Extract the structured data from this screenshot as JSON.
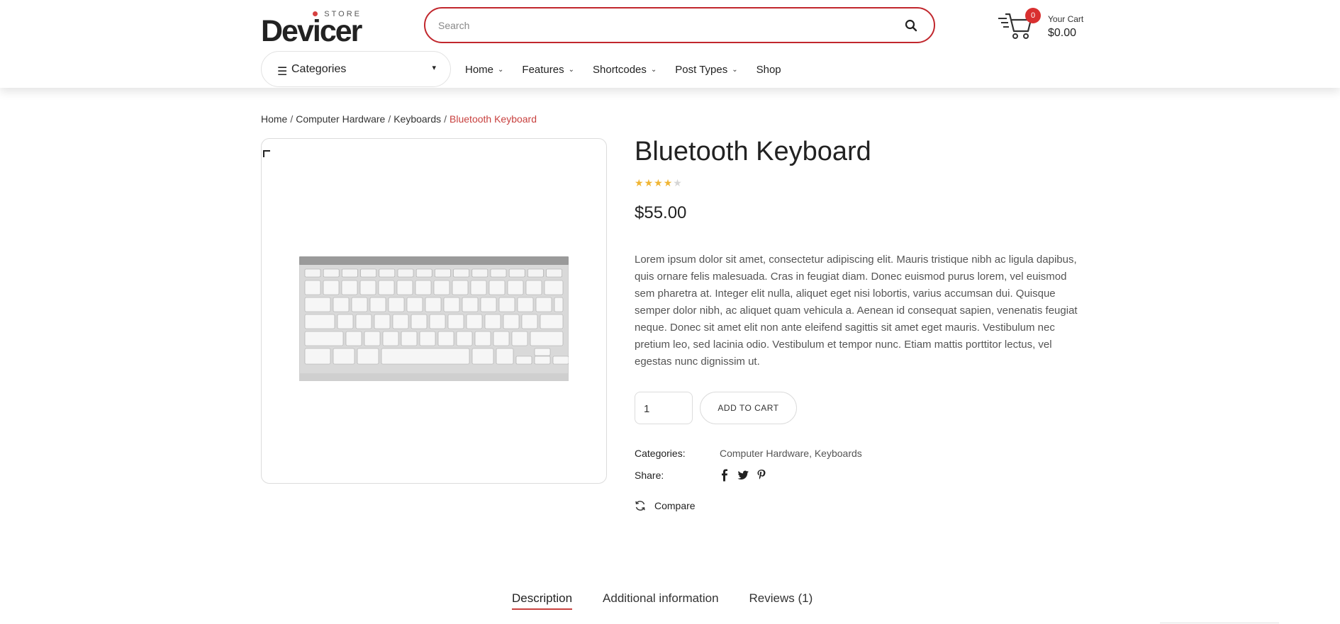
{
  "header": {
    "logo": {
      "store": "STORE",
      "name": "Devicer"
    },
    "search": {
      "placeholder": "Search",
      "value": ""
    },
    "cart": {
      "count": "0",
      "label": "Your Cart",
      "amount": "$0.00"
    },
    "categories_label": "Categories",
    "nav": [
      {
        "label": "Home",
        "has_dropdown": true
      },
      {
        "label": "Features",
        "has_dropdown": true
      },
      {
        "label": "Shortcodes",
        "has_dropdown": true
      },
      {
        "label": "Post Types",
        "has_dropdown": true
      },
      {
        "label": "Shop",
        "has_dropdown": false
      }
    ]
  },
  "breadcrumb": {
    "items": [
      "Home",
      "Computer Hardware",
      "Keyboards"
    ],
    "separator": "/",
    "current": "Bluetooth Keyboard"
  },
  "product": {
    "title": "Bluetooth Keyboard",
    "rating": 4,
    "rating_max": 5,
    "price": "$55.00",
    "description": "Lorem ipsum dolor sit amet, consectetur adipiscing elit. Mauris tristique nibh ac ligula dapibus, quis ornare felis malesuada. Cras in feugiat diam. Donec euismod purus lorem, vel euismod sem pharetra at. Integer elit nulla, aliquet eget nisi lobortis, varius accumsan dui. Quisque semper dolor nibh, ac aliquet quam vehicula a. Aenean id consequat sapien, venenatis feugiat neque. Donec sit amet elit non ante eleifend sagittis sit amet eget mauris. Vestibulum nec pretium leo, sed lacinia odio. Vestibulum et tempor nunc. Etiam mattis porttitor lectus, vel egestas nunc dignissim ut.",
    "quantity": "1",
    "add_to_cart": "ADD TO CART",
    "categories_label": "Categories:",
    "categories": [
      "Computer Hardware",
      "Keyboards"
    ],
    "share_label": "Share:",
    "share_icons": [
      "facebook-icon",
      "twitter-icon",
      "pinterest-icon"
    ],
    "compare_label": "Compare"
  },
  "tabs": [
    {
      "label": "Description",
      "active": true
    },
    {
      "label": "Additional information",
      "active": false
    },
    {
      "label": "Reviews (1)",
      "active": false
    }
  ],
  "colors": {
    "accent": "#c8413f",
    "search_border": "#c1272d",
    "badge": "#d93030",
    "star": "#f0b534"
  }
}
